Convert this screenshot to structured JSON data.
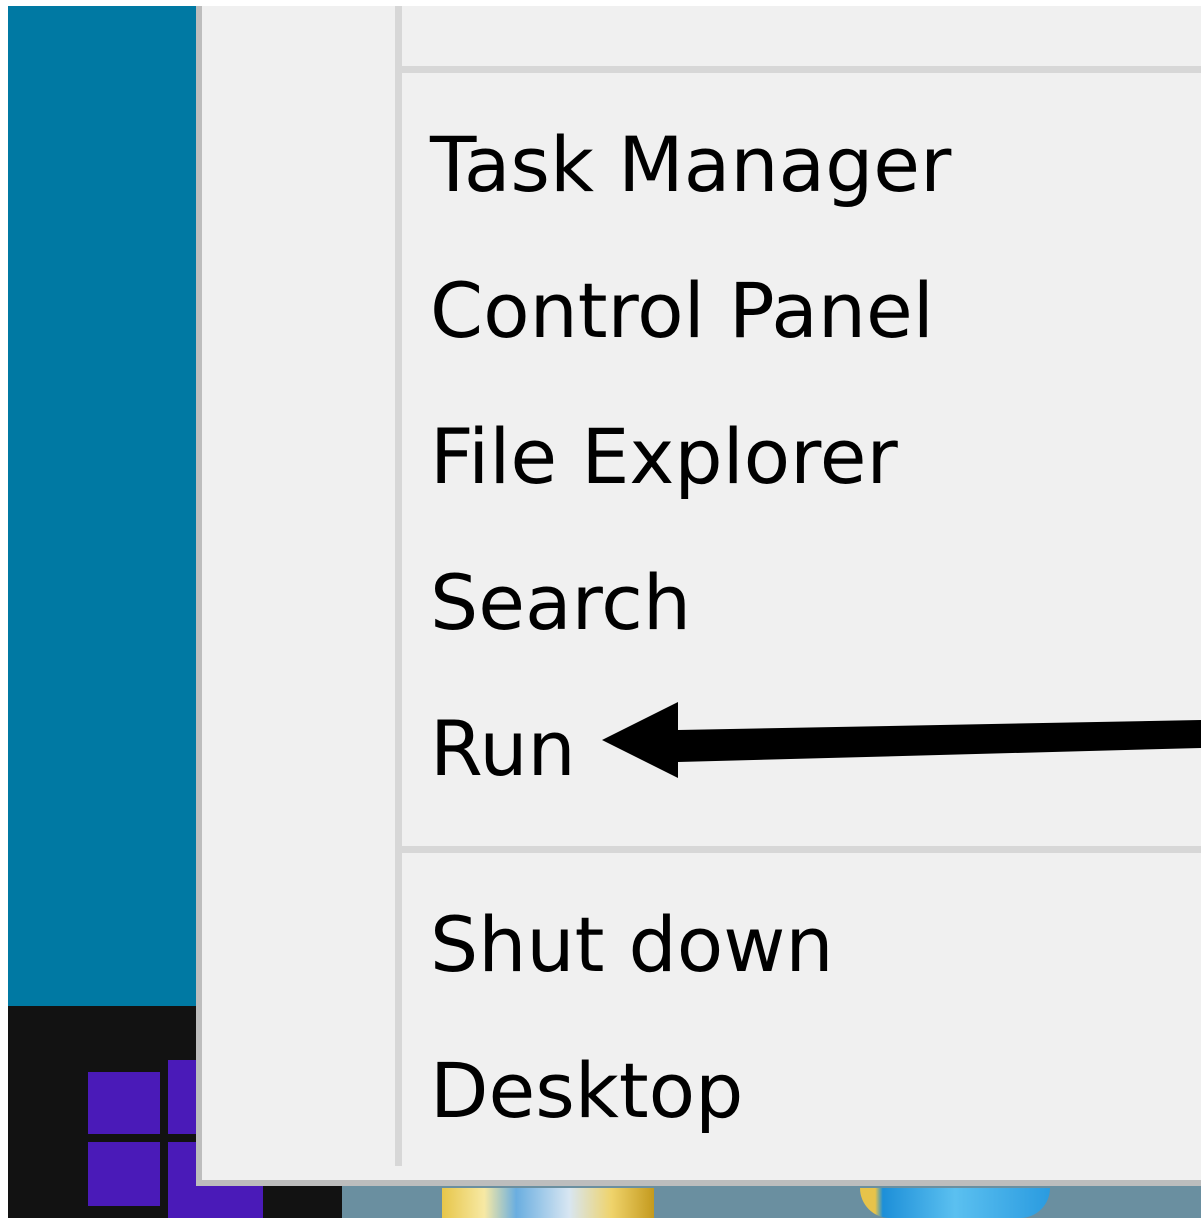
{
  "menu": {
    "items": [
      {
        "label": "Task Manager"
      },
      {
        "label": "Control Panel"
      },
      {
        "label": "File Explorer"
      },
      {
        "label": "Search"
      },
      {
        "label": "Run"
      },
      {
        "label": "Shut down"
      },
      {
        "label": "Desktop"
      }
    ]
  },
  "annotation": {
    "icon": "arrow-left-icon",
    "color": "#000000"
  },
  "colors": {
    "desktop": "#0079a3",
    "taskbar": "#121212",
    "menu_background": "#f0f0f0",
    "windows_logo": "#4a1ab8"
  }
}
